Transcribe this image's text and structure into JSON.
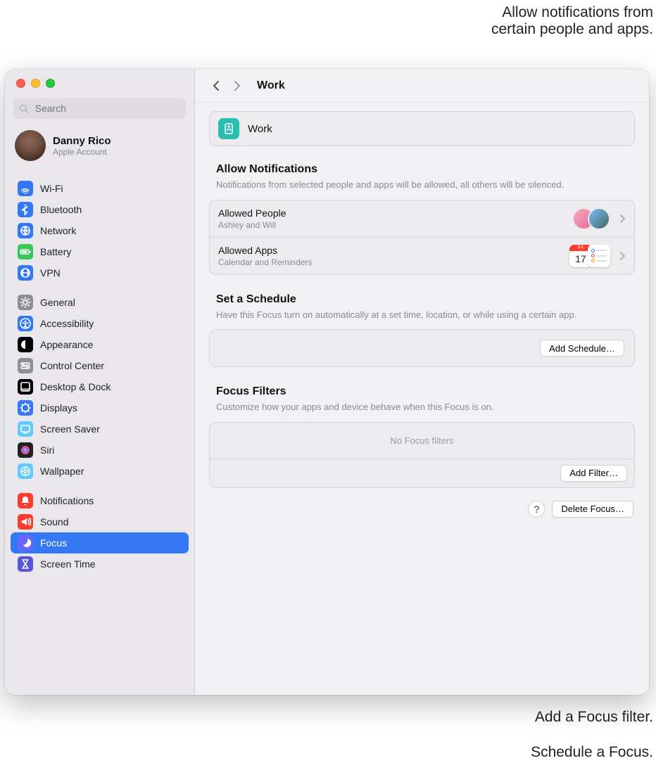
{
  "callouts": {
    "top": "Allow notifications from\ncertain people and apps.",
    "bottom1": "Add a Focus filter.",
    "bottom2": "Schedule a Focus."
  },
  "search": {
    "placeholder": "Search"
  },
  "account": {
    "name": "Danny Rico",
    "type": "Apple Account"
  },
  "sidebar": {
    "groups": [
      [
        {
          "label": "Wi-Fi",
          "color": "#3478f6",
          "glyph": "wifi"
        },
        {
          "label": "Bluetooth",
          "color": "#3478f6",
          "glyph": "bt"
        },
        {
          "label": "Network",
          "color": "#3478f6",
          "glyph": "globe"
        },
        {
          "label": "Battery",
          "color": "#34c759",
          "glyph": "battery"
        },
        {
          "label": "VPN",
          "color": "#3478f6",
          "glyph": "vpn"
        }
      ],
      [
        {
          "label": "General",
          "color": "#8e8e93",
          "glyph": "gear"
        },
        {
          "label": "Accessibility",
          "color": "#3478f6",
          "glyph": "acc"
        },
        {
          "label": "Appearance",
          "color": "#000",
          "glyph": "appear"
        },
        {
          "label": "Control Center",
          "color": "#8e8e93",
          "glyph": "cc"
        },
        {
          "label": "Desktop & Dock",
          "color": "#000",
          "glyph": "dock"
        },
        {
          "label": "Displays",
          "color": "#3478f6",
          "glyph": "display"
        },
        {
          "label": "Screen Saver",
          "color": "#63c8ff",
          "glyph": "ss"
        },
        {
          "label": "Siri",
          "color": "#222",
          "glyph": "siri"
        },
        {
          "label": "Wallpaper",
          "color": "#63c8ff",
          "glyph": "wall"
        }
      ],
      [
        {
          "label": "Notifications",
          "color": "#ff3b30",
          "glyph": "bell"
        },
        {
          "label": "Sound",
          "color": "#ff3b30",
          "glyph": "sound"
        },
        {
          "label": "Focus",
          "color": "#5856d6",
          "glyph": "moon",
          "selected": true
        },
        {
          "label": "Screen Time",
          "color": "#5856d6",
          "glyph": "hourglass"
        }
      ]
    ]
  },
  "header": {
    "title": "Work"
  },
  "focusCard": {
    "title": "Work"
  },
  "sections": {
    "allow": {
      "title": "Allow Notifications",
      "subtitle": "Notifications from selected people and apps will be allowed, all others will be silenced.",
      "people": {
        "title": "Allowed People",
        "subtitle": "Ashley and Will"
      },
      "apps": {
        "title": "Allowed Apps",
        "subtitle": "Calendar and Reminders"
      }
    },
    "schedule": {
      "title": "Set a Schedule",
      "subtitle": "Have this Focus turn on automatically at a set time, location, or while using a certain app.",
      "button": "Add Schedule…"
    },
    "filters": {
      "title": "Focus Filters",
      "subtitle": "Customize how your apps and device behave when this Focus is on.",
      "empty": "No Focus filters",
      "button": "Add Filter…"
    },
    "footer": {
      "help": "?",
      "delete": "Delete Focus…"
    }
  },
  "iconNames": {
    "wifi": "wifi-icon",
    "bt": "bluetooth-icon",
    "globe": "network-icon",
    "battery": "battery-icon",
    "vpn": "vpn-icon",
    "gear": "gear-icon",
    "acc": "accessibility-icon",
    "appear": "appearance-icon",
    "cc": "control-center-icon",
    "dock": "desktop-dock-icon",
    "display": "displays-icon",
    "ss": "screen-saver-icon",
    "siri": "siri-icon",
    "wall": "wallpaper-icon",
    "bell": "notifications-icon",
    "sound": "sound-icon",
    "moon": "focus-icon",
    "hourglass": "screen-time-icon"
  }
}
